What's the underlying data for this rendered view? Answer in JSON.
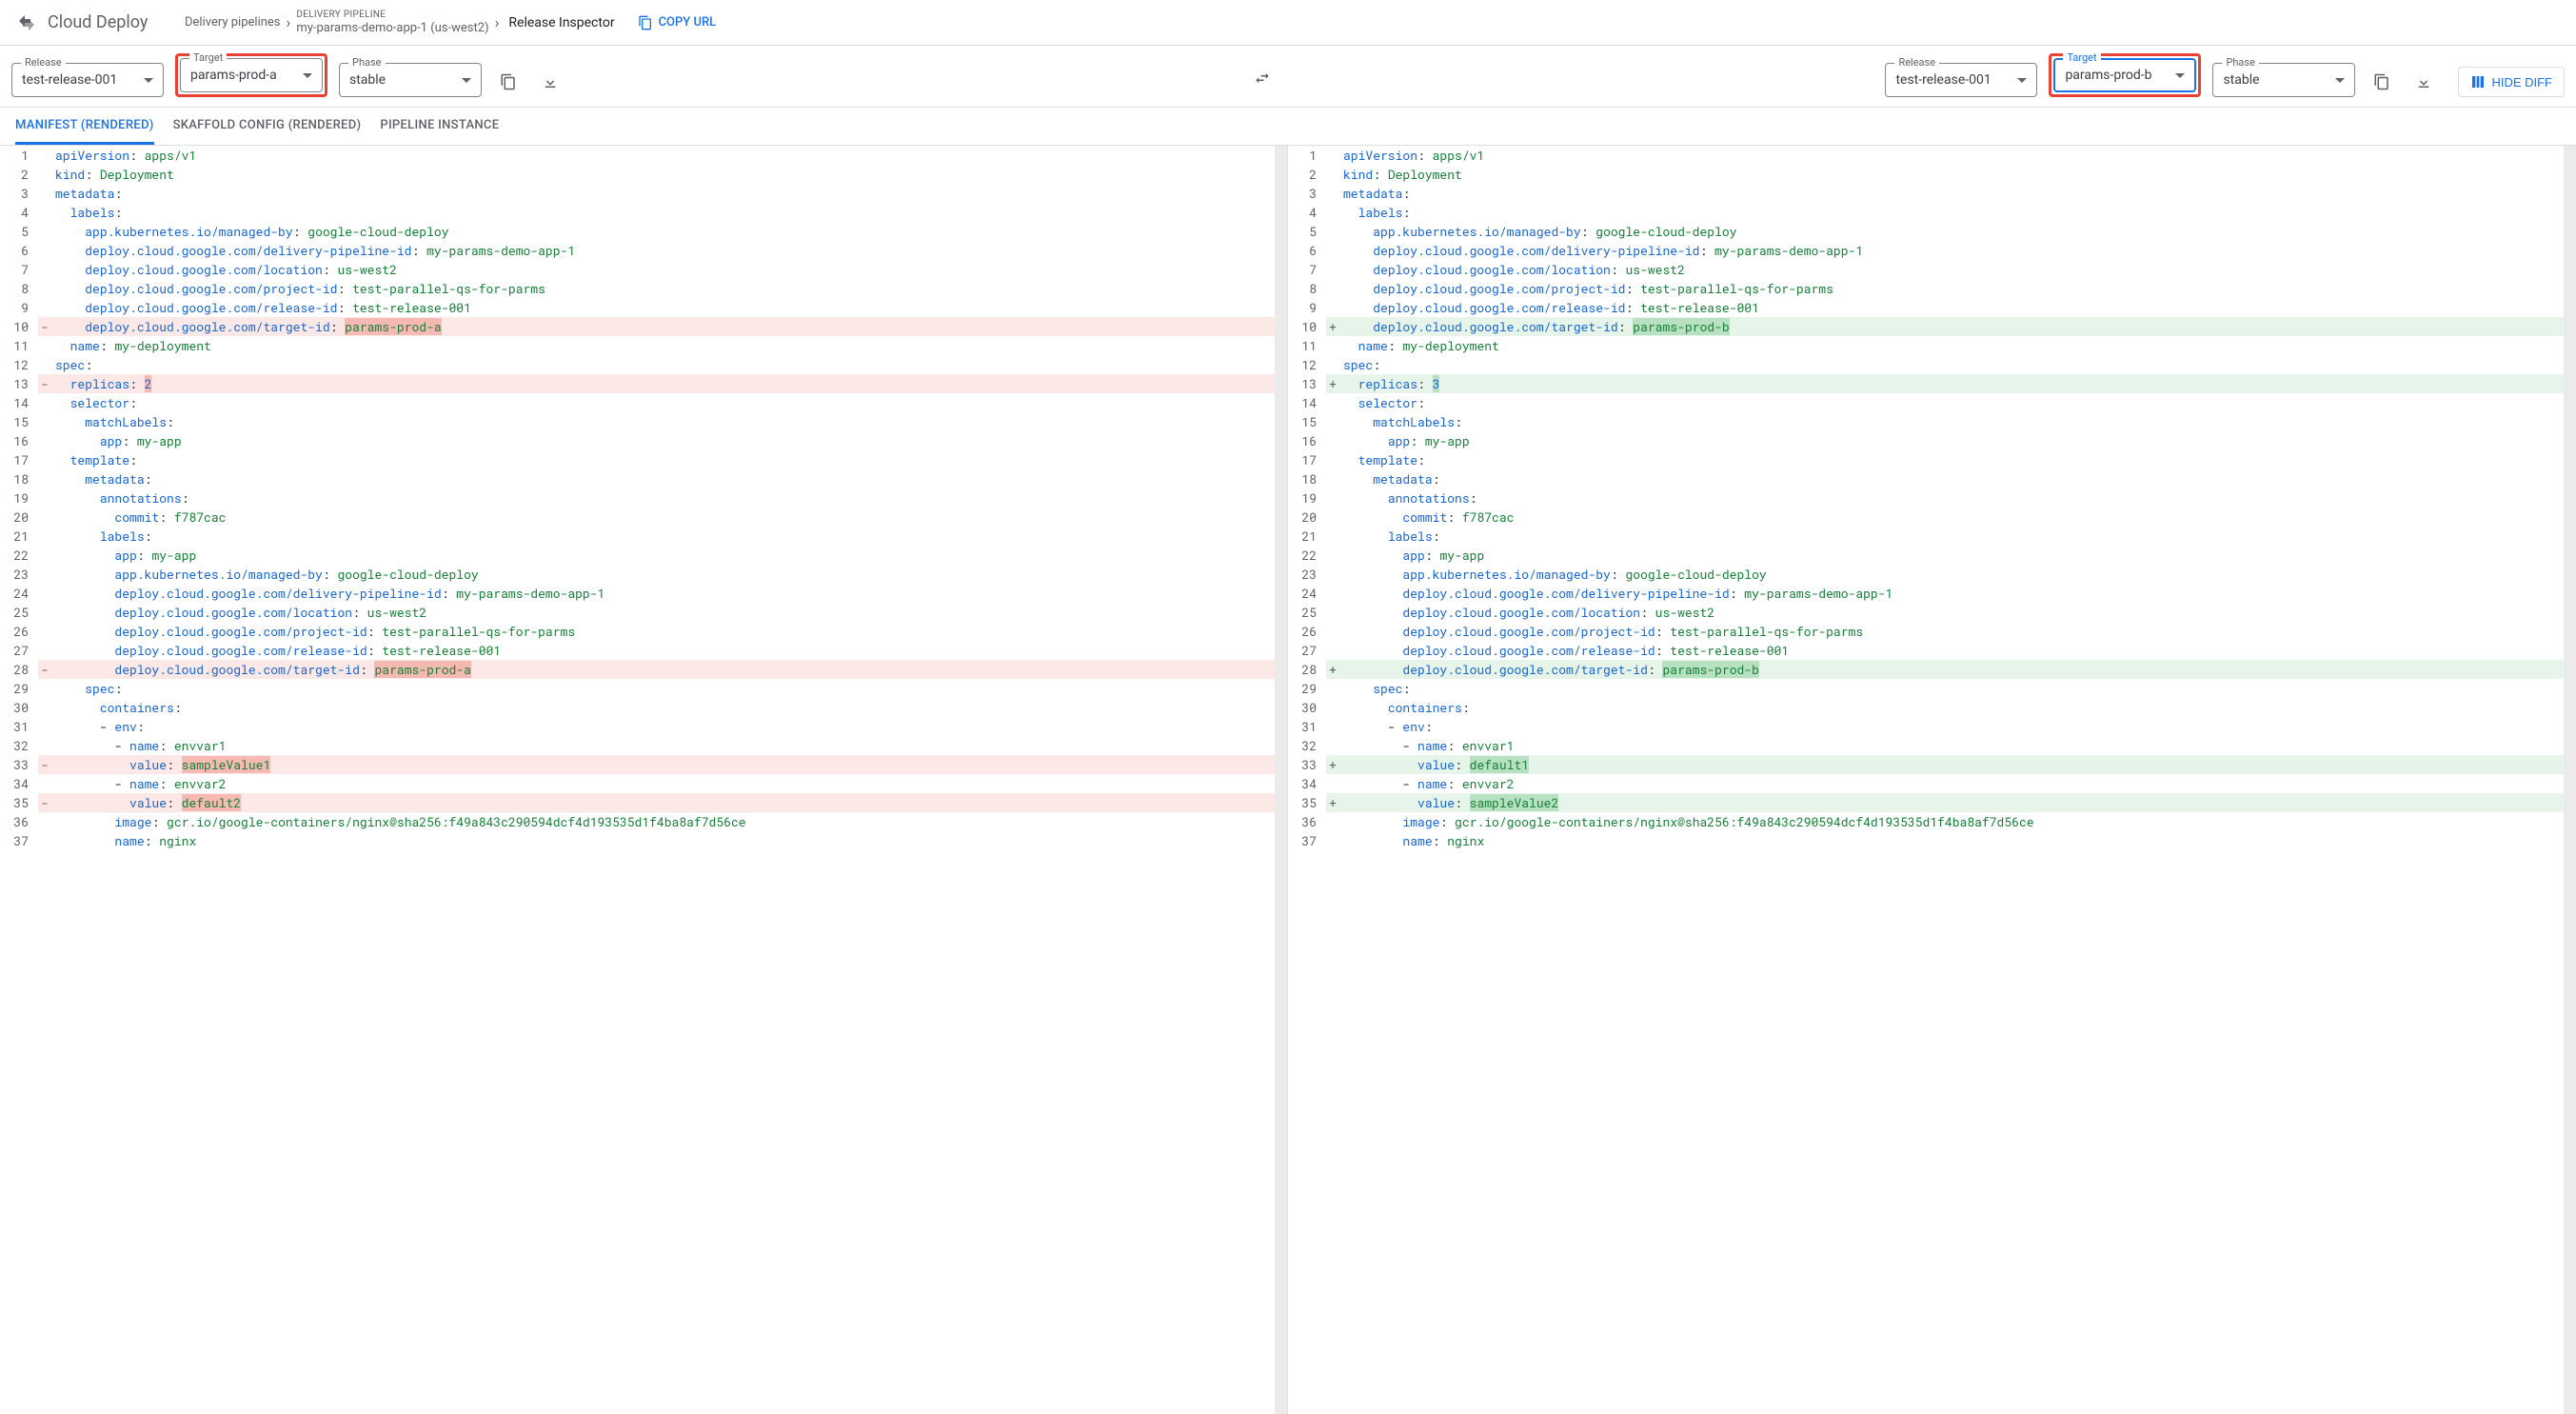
{
  "header": {
    "product": "Cloud Deploy",
    "crumb1": "Delivery pipelines",
    "pipeline_label": "DELIVERY PIPELINE",
    "pipeline_name": "my-params-demo-app-1 (us-west2)",
    "page_title": "Release Inspector",
    "copy_url": "COPY URL"
  },
  "selectors": {
    "release_label": "Release",
    "target_label": "Target",
    "phase_label": "Phase",
    "left": {
      "release": "test-release-001",
      "target": "params-prod-a",
      "phase": "stable"
    },
    "right": {
      "release": "test-release-001",
      "target": "params-prod-b",
      "phase": "stable"
    },
    "hide_diff": "HIDE DIFF"
  },
  "tabs": {
    "t1": "MANIFEST (RENDERED)",
    "t2": "SKAFFOLD CONFIG (RENDERED)",
    "t3": "PIPELINE INSTANCE"
  },
  "yaml": {
    "managed_by_val": "google-cloud-deploy",
    "delivery_pipeline_val": "my-params-demo-app-1",
    "location_val": "us-west2",
    "project_id_val": "test-parallel-qs-for-parms",
    "release_id_val": "test-release-001",
    "target_id_left": "params-prod-a",
    "target_id_right": "params-prod-b",
    "deployment_name": "my-deployment",
    "replicas_left": "2",
    "replicas_right": "3",
    "app_label": "my-app",
    "commit": "f787cac",
    "envvar1": "envvar1",
    "envvar2": "envvar2",
    "val1_left": "sampleValue1",
    "val2_left": "default2",
    "val1_right": "default1",
    "val2_right": "sampleValue2",
    "image": "gcr.io/google-containers/nginx@sha256:f49a843c290594dcf4d193535d1f4ba8af7d56ce",
    "container_name": "nginx"
  }
}
